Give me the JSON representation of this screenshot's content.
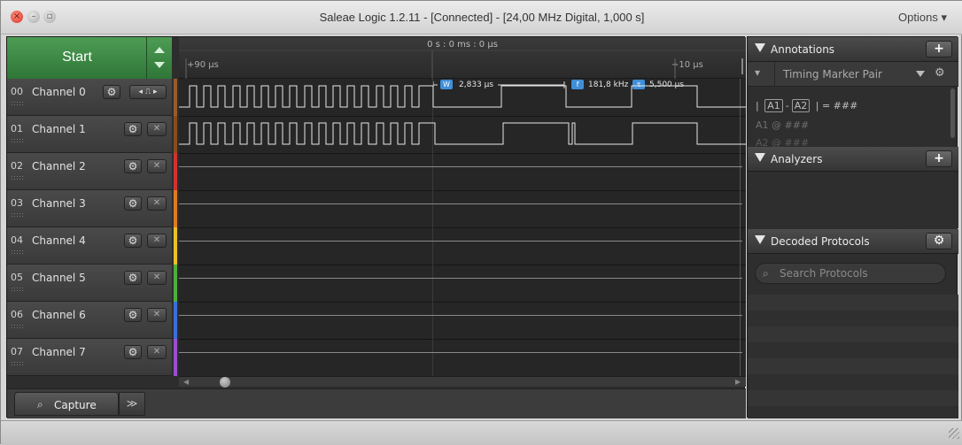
{
  "window": {
    "title": "Saleae Logic 1.2.11 - [Connected] - [24,00 MHz Digital, 1,000 s]",
    "options_label": "Options ▾",
    "close_glyph": "×",
    "minimize_glyph": "–",
    "maximize_glyph": "▫"
  },
  "capture": {
    "start_label": "Start"
  },
  "ruler": {
    "center_label": "0 s : 0 ms : 0 μs",
    "left_label": "+90 μs",
    "right_label": "+10 μs"
  },
  "measurements": {
    "width_badge": "W",
    "width_value": "2,833 μs",
    "freq_badge": "f",
    "freq_value": "181,8 kHz",
    "period_badge": "τ",
    "period_value": "5,500 μs"
  },
  "channels": [
    {
      "num": "00",
      "name": "Channel 0",
      "color": "#9a5a2a"
    },
    {
      "num": "01",
      "name": "Channel 1",
      "color": "#8b4a1f"
    },
    {
      "num": "02",
      "name": "Channel 2",
      "color": "#d23232"
    },
    {
      "num": "03",
      "name": "Channel 3",
      "color": "#e07a22"
    },
    {
      "num": "04",
      "name": "Channel 4",
      "color": "#e8c228"
    },
    {
      "num": "05",
      "name": "Channel 5",
      "color": "#4caf3c"
    },
    {
      "num": "06",
      "name": "Channel 6",
      "color": "#3a6fd8"
    },
    {
      "num": "07",
      "name": "Channel 7",
      "color": "#9a4ed0"
    }
  ],
  "icons": {
    "gear": "⚙",
    "close": "✕",
    "trigger_left": "◂",
    "trigger_pulse": "⎍",
    "trigger_right": "▸",
    "search": "⌕",
    "more": "≫",
    "pin": "📍"
  },
  "bottom_tabs": {
    "capture_label": "Capture"
  },
  "sidebar": {
    "annotations": {
      "label": "Annotations",
      "add_label": "+",
      "marker_type": "Timing Marker Pair",
      "a1": "A1",
      "a2": "A2",
      "line1_prefix": "|",
      "line1_dash": "-",
      "line1_suffix": "| = ###",
      "line2": "A1  @  ###",
      "line3": "A2  @  ###"
    },
    "analyzers": {
      "label": "Analyzers",
      "add_label": "+"
    },
    "decoded_protocols": {
      "label": "Decoded Protocols",
      "search_placeholder": "Search Protocols"
    }
  },
  "colors": {
    "accent_green": "#3f8a47",
    "marker_blue": "#3f8fd8"
  }
}
